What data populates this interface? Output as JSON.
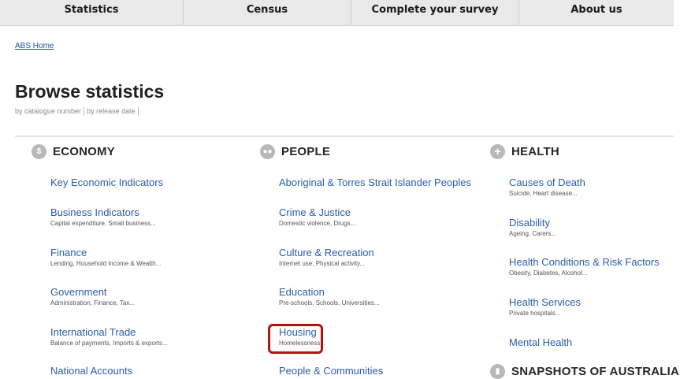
{
  "topnav": {
    "items": [
      "Statistics",
      "Census",
      "Complete your survey",
      "About us"
    ]
  },
  "breadcrumb": "ABS Home",
  "page": {
    "title": "Browse statistics",
    "by_catalogue": "by catalogue number",
    "by_release": "by release date"
  },
  "economy": {
    "title": "ECONOMY",
    "items": [
      {
        "title": "Key Economic Indicators",
        "desc": ""
      },
      {
        "title": "Business Indicators",
        "desc": "Capital expenditure, Small business..."
      },
      {
        "title": "Finance",
        "desc": "Lending, Household income & Wealth..."
      },
      {
        "title": "Government",
        "desc": "Administration, Finance, Tax..."
      },
      {
        "title": "International Trade",
        "desc": "Balance of payments, Imports & exports..."
      },
      {
        "title": "National Accounts",
        "desc": ""
      }
    ]
  },
  "people": {
    "title": "PEOPLE",
    "items": [
      {
        "title": "Aboriginal & Torres Strait Islander Peoples",
        "desc": ""
      },
      {
        "title": "Crime & Justice",
        "desc": "Domestic violence, Drugs..."
      },
      {
        "title": "Culture & Recreation",
        "desc": "Internet use, Physical activity..."
      },
      {
        "title": "Education",
        "desc": "Pre-schools, Schools, Universities..."
      },
      {
        "title": "Housing",
        "desc": "Homelessness..."
      },
      {
        "title": "People & Communities",
        "desc": ""
      }
    ]
  },
  "health": {
    "title": "HEALTH",
    "items": [
      {
        "title": "Causes of Death",
        "desc": "Suicide, Heart disease..."
      },
      {
        "title": "Disability",
        "desc": "Ageing, Carers..."
      },
      {
        "title": "Health Conditions & Risk Factors",
        "desc": "Obesity, Diabetes, Alcohol..."
      },
      {
        "title": "Health Services",
        "desc": "Private hospitals..."
      },
      {
        "title": "Mental Health",
        "desc": ""
      }
    ]
  },
  "snapshots": {
    "title": "SNAPSHOTS OF AUSTRALIA"
  },
  "colors": {
    "link": "#2a5daa",
    "highlight": "#b31212"
  }
}
